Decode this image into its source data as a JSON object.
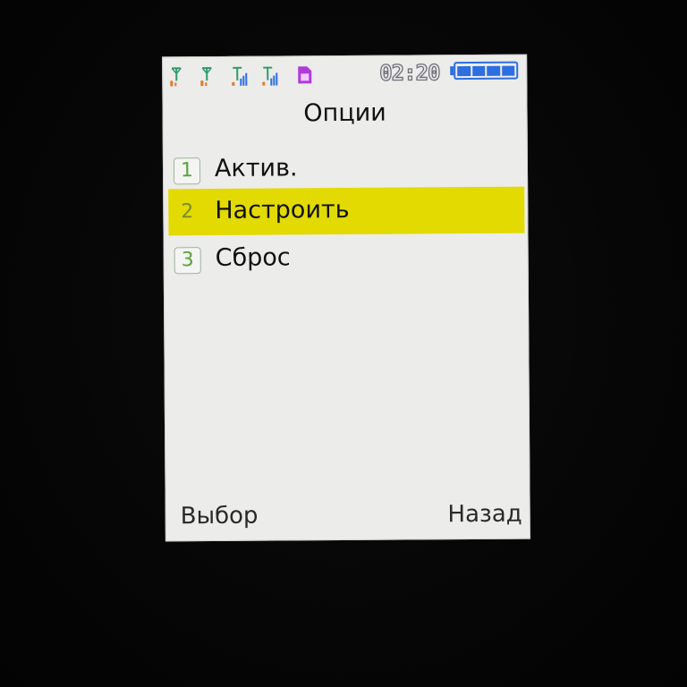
{
  "status_bar": {
    "icons": [
      "signal-icon",
      "signal-icon",
      "signal-bars-icon",
      "signal-bars-icon",
      "sim-card-icon"
    ],
    "time": "02:20",
    "battery_icon": "battery-full-icon",
    "colors": {
      "signal_antenna": "#2f9b6a",
      "signal_bars": "#2d6ee0",
      "signal_base": "#e07a2c",
      "sim": "#b03ad9",
      "battery": "#2d6ee0"
    }
  },
  "title": "Опции",
  "menu": {
    "items": [
      {
        "number": "1",
        "label": "Актив."
      },
      {
        "number": "2",
        "label": "Настроить",
        "selected": true
      },
      {
        "number": "3",
        "label": "Сброс"
      }
    ],
    "highlight_color": "#e2da00"
  },
  "softkeys": {
    "left": "Выбор",
    "right": "Назад"
  }
}
